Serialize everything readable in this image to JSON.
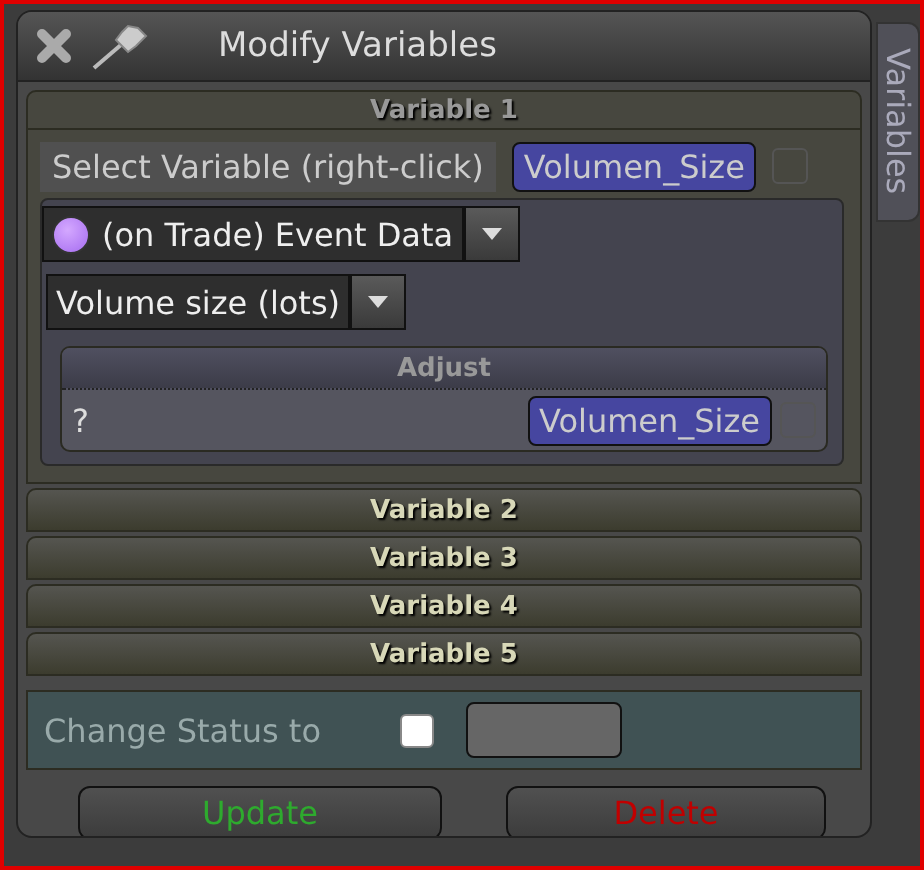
{
  "window": {
    "title": "Modify Variables"
  },
  "side_tab": {
    "label": "Variables"
  },
  "variables": [
    {
      "title": "Variable 1",
      "expanded": true,
      "select_label": "Select Variable (right-click)",
      "variable_name": "Volumen_Size",
      "source": "(on Trade) Event Data",
      "field": "Volume size (lots)",
      "adjust": {
        "title": "Adjust",
        "operator": "?",
        "variable_name": "Volumen_Size"
      }
    },
    {
      "title": "Variable 2",
      "expanded": false
    },
    {
      "title": "Variable 3",
      "expanded": false
    },
    {
      "title": "Variable 4",
      "expanded": false
    },
    {
      "title": "Variable 5",
      "expanded": false
    }
  ],
  "status": {
    "label": "Change Status to",
    "checked": false
  },
  "buttons": [
    {
      "label": "Update",
      "kind": "update"
    },
    {
      "label": "Delete",
      "kind": "delete"
    }
  ]
}
